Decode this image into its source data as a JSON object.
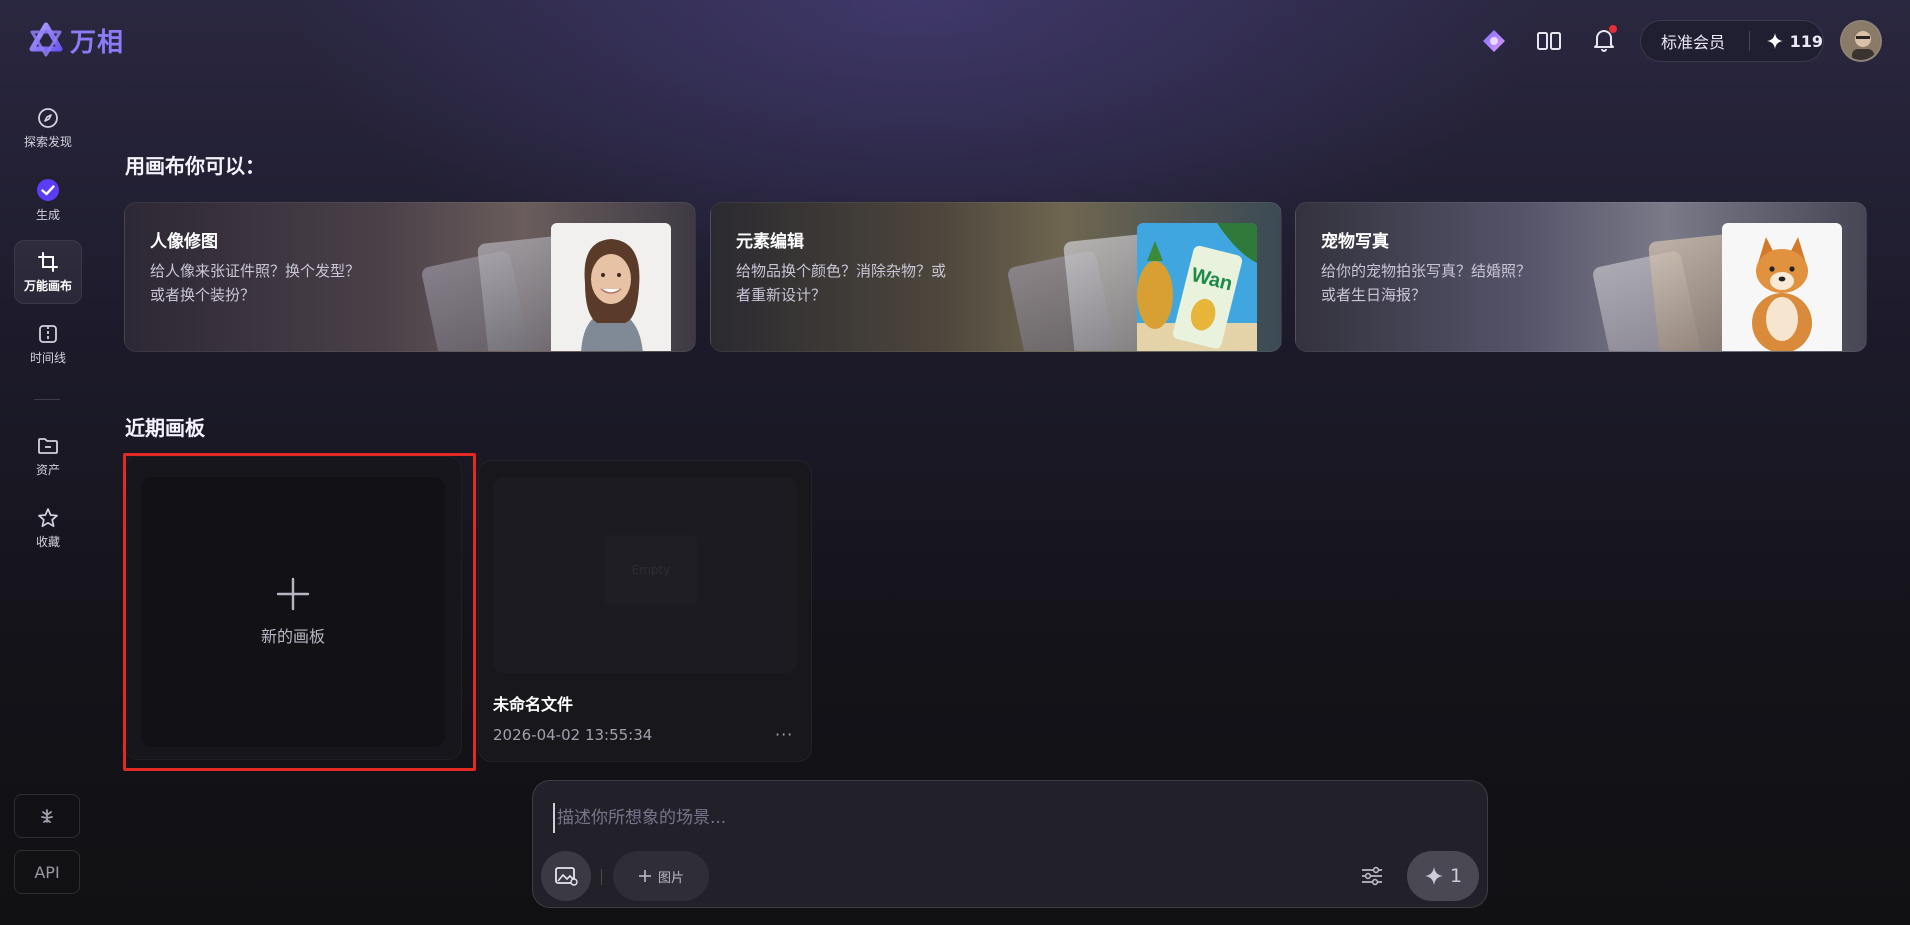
{
  "app": {
    "name": "万相",
    "brand_color": "#8a7cf6"
  },
  "header": {
    "icons": [
      "app-switch-icon",
      "layout-icon",
      "bell-icon"
    ],
    "membership_label": "标准会员",
    "points": "119"
  },
  "sidebar": {
    "items": [
      {
        "label": "探索发现",
        "icon": "compass-icon"
      },
      {
        "label": "生成",
        "icon": "check-circle-icon"
      },
      {
        "label": "万能画布",
        "icon": "canvas-icon",
        "active": true
      },
      {
        "label": "时间线",
        "icon": "timeline-icon"
      },
      {
        "label": "资产",
        "icon": "folder-icon"
      },
      {
        "label": "收藏",
        "icon": "star-icon"
      }
    ],
    "bottom": {
      "api_label": "API"
    }
  },
  "canvas_section": {
    "heading": "用画布你可以：",
    "cards": [
      {
        "title": "人像修图",
        "desc_line1": "给人像来张证件照？换个发型？",
        "desc_line2": "或者换个装扮？"
      },
      {
        "title": "元素编辑",
        "desc_line1": "给物品换个颜色？消除杂物？或",
        "desc_line2": "者重新设计？"
      },
      {
        "title": "宠物写真",
        "desc_line1": "给你的宠物拍张写真？结婚照？",
        "desc_line2": "或者生日海报？"
      }
    ]
  },
  "recent": {
    "heading": "近期画板",
    "new_board_label": "新的画板",
    "files": [
      {
        "name": "未命名文件",
        "date": "2026-04-02 13:55:34",
        "thumb_text": "Empty",
        "more": "···"
      }
    ]
  },
  "prompt": {
    "placeholder": "描述你所想象的场景...",
    "image_button_label": "图片",
    "send_count": "1"
  }
}
